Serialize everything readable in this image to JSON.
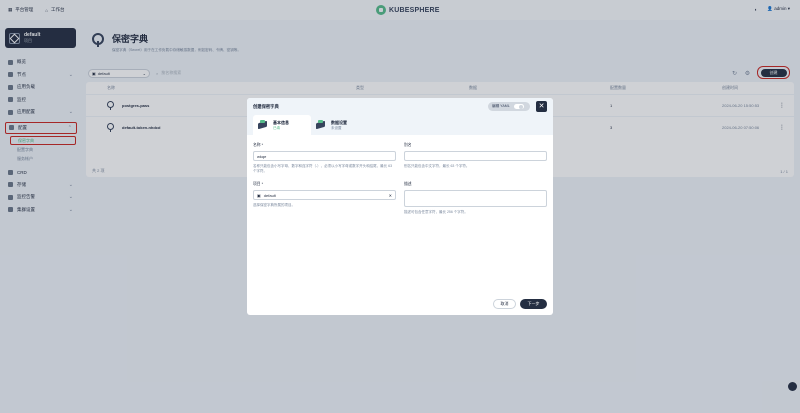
{
  "topbar": {
    "platform_label": "平台管理",
    "workbench_label": "工作台",
    "brand": "KUBESPHERE",
    "user": "admin"
  },
  "sidebar": {
    "workspace_name": "default",
    "workspace_sub": "项目",
    "items": [
      {
        "label": "概览"
      },
      {
        "label": "节点"
      },
      {
        "label": "应用负载"
      },
      {
        "label": "监控"
      },
      {
        "label": "应用配置"
      },
      {
        "label": "配置"
      },
      {
        "label": "保密字典"
      },
      {
        "label": "配置字典"
      },
      {
        "label": "服务帐户"
      },
      {
        "label": "CRD"
      },
      {
        "label": "存储"
      },
      {
        "label": "监控告警"
      },
      {
        "label": "集群设置"
      }
    ]
  },
  "page": {
    "title": "保密字典",
    "desc": "保密字典（Secret）用于在工作负载中存储敏感数据，例如密码、令牌、密钥等。"
  },
  "toolbar": {
    "namespace": "default",
    "search_placeholder": "按名称搜索",
    "create_label": "创建"
  },
  "table": {
    "columns": [
      "名称",
      "类型",
      "数据",
      "配置数量",
      "创建时间"
    ],
    "rows": [
      {
        "name": "postgres-pass",
        "count": "1",
        "time": "2024-06-20 15:50:53"
      },
      {
        "name": "default-token-nhdcd",
        "count": "3",
        "time": "2024-06-20 07:50:06"
      }
    ],
    "footer_total": "共 2 项",
    "pager": "1 / 1"
  },
  "modal": {
    "title": "创建保密字典",
    "yaml_label": "编辑 YAML",
    "steps": [
      {
        "title": "基本信息",
        "sub": "已填"
      },
      {
        "title": "数据设置",
        "sub": "未设置"
      }
    ],
    "name_label": "名称 *",
    "name_value": "wkqe",
    "name_hint": "名称只能包含小写字母、数字和连字符（-），必须以小写字母或数字开头和结尾，最长 63 个字符。",
    "alias_label": "别名",
    "alias_hint": "别名只能包含中文字符，最长 63 个字符。",
    "project_label": "项目 *",
    "project_value": "default",
    "project_hint": "选择保密字典所属的项目。",
    "desc_label": "描述",
    "desc_hint": "描述可包含任意字符，最长 256 个字符。",
    "cancel_label": "取消",
    "next_label": "下一步"
  },
  "colors": {
    "accent": "#55bc8a",
    "dark": "#242e42",
    "highlight": "#ca2621"
  }
}
